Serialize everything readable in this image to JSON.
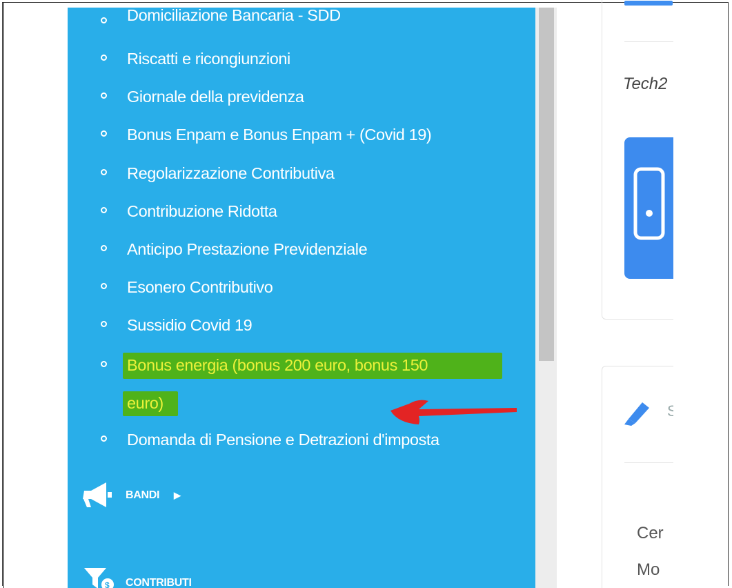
{
  "sidebar": {
    "background": "#29aee9",
    "items": [
      {
        "label": "Domiciliazione Bancaria - SDD"
      },
      {
        "label": "Riscatti e ricongiunzioni"
      },
      {
        "label": "Giornale della previdenza"
      },
      {
        "label": "Bonus Enpam e Bonus Enpam + (Covid 19)"
      },
      {
        "label": "Regolarizzazione Contributiva"
      },
      {
        "label": "Contribuzione Ridotta"
      },
      {
        "label": "Anticipo Prestazione Previdenziale"
      },
      {
        "label": "Esonero Contributivo"
      },
      {
        "label": "Sussidio Covid 19"
      },
      {
        "label": "Bonus energia (bonus 200 euro, bonus 150",
        "label_cont": "euro)",
        "highlighted": true
      },
      {
        "label": "Domanda di Pensione e Detrazioni d'imposta"
      }
    ],
    "sections": [
      {
        "label": "BANDI",
        "icon": "megaphone-icon",
        "has_caret": true
      },
      {
        "label": "CONTRIBUTI",
        "icon": "filter-icon"
      }
    ]
  },
  "annotation": {
    "arrow_color": "#e32424",
    "highlight_band": "#4fb21a",
    "highlight_text": "#ecf13a"
  },
  "right_panel": {
    "card1_text": "Tech2",
    "card2_header": "S",
    "card2_lines": [
      "Cer",
      "Mo"
    ]
  }
}
